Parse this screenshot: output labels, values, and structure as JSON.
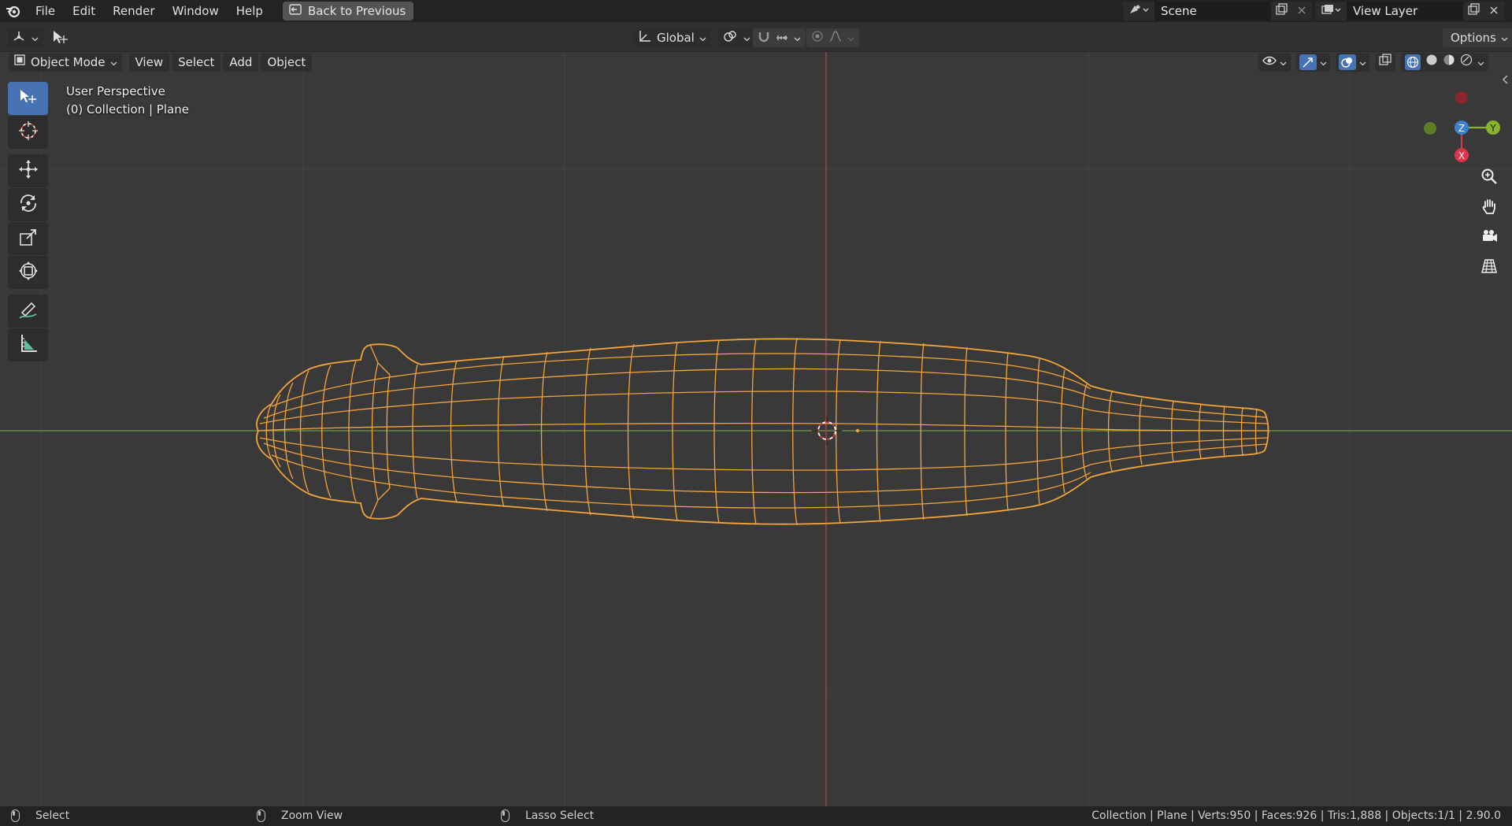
{
  "menubar": {
    "items": [
      "File",
      "Edit",
      "Render",
      "Window",
      "Help"
    ],
    "back_button": "Back to Previous"
  },
  "scene": {
    "name": "Scene",
    "view_layer": "View Layer"
  },
  "header": {
    "transform_orientation": "Global",
    "options_label": "Options"
  },
  "viewport_header": {
    "mode": "Object Mode",
    "menus": [
      "View",
      "Select",
      "Add",
      "Object"
    ]
  },
  "overlay": {
    "view_name": "User Perspective",
    "collection_info": "(0) Collection | Plane"
  },
  "gizmo": {
    "z": "Z",
    "y": "Y",
    "x": "X"
  },
  "toolbar": {
    "tools": [
      "select-box-icon",
      "cursor-icon",
      "move-icon",
      "rotate-icon",
      "scale-icon",
      "transform-icon",
      "annotate-icon",
      "measure-icon"
    ],
    "active": "select-box-icon"
  },
  "statusbar": {
    "left_action": "Select",
    "middle_action": "Zoom View",
    "right_action": "Lasso Select",
    "stats": "Collection | Plane | Verts:950 | Faces:926 | Tris:1,888 | Objects:1/1 | 2.90.0"
  },
  "colors": {
    "selection": "#f5a43a",
    "active_tool": "#4772b3",
    "axis_x": "#cc4040",
    "axis_y": "#77a339",
    "viewport_bg": "#393939"
  }
}
